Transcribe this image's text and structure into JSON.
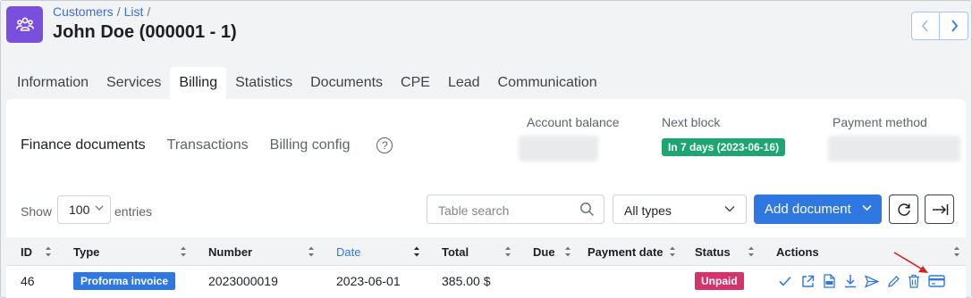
{
  "breadcrumb": {
    "item1": "Customers",
    "item2": "List",
    "separator": "/"
  },
  "page_title": "John Doe (000001 - 1)",
  "tabs": [
    {
      "label": "Information"
    },
    {
      "label": "Services"
    },
    {
      "label": "Billing",
      "active": true
    },
    {
      "label": "Statistics"
    },
    {
      "label": "Documents"
    },
    {
      "label": "CPE"
    },
    {
      "label": "Lead"
    },
    {
      "label": "Communication"
    }
  ],
  "subtabs": [
    {
      "label": "Finance documents",
      "active": true
    },
    {
      "label": "Transactions"
    },
    {
      "label": "Billing config"
    }
  ],
  "help_glyph": "?",
  "summary": {
    "account_balance_label": "Account balance",
    "next_block_label": "Next block",
    "next_block_value": "In 7 days (2023-06-16)",
    "payment_method_label": "Payment method"
  },
  "controls": {
    "show_label": "Show",
    "entries_value": "100",
    "entries_label": "entries",
    "search_placeholder": "Table search",
    "type_filter": "All types",
    "add_document": "Add document"
  },
  "table": {
    "headers": [
      "ID",
      "Type",
      "Number",
      "Date",
      "Total",
      "Due",
      "Payment date",
      "Status",
      "Actions"
    ],
    "rows": [
      {
        "id": "46",
        "type": "Proforma invoice",
        "number": "2023000019",
        "date": "2023-06-01",
        "total": "385.00 $",
        "due": "",
        "payment_date": "",
        "status": "Unpaid"
      }
    ]
  },
  "colors": {
    "accent": "#2f78e2",
    "app_icon": "#7b4fde",
    "success_badge": "#1ea672",
    "unpaid_badge": "#d6336c",
    "annotation_arrow": "#d62020"
  },
  "icons": {
    "app": "users-group-icon",
    "prev": "chevron-left-icon",
    "next": "chevron-right-icon",
    "actions": [
      "check-icon",
      "open-external-icon",
      "pdf-icon",
      "download-icon",
      "send-icon",
      "edit-icon",
      "delete-icon",
      "payment-card-icon"
    ]
  }
}
